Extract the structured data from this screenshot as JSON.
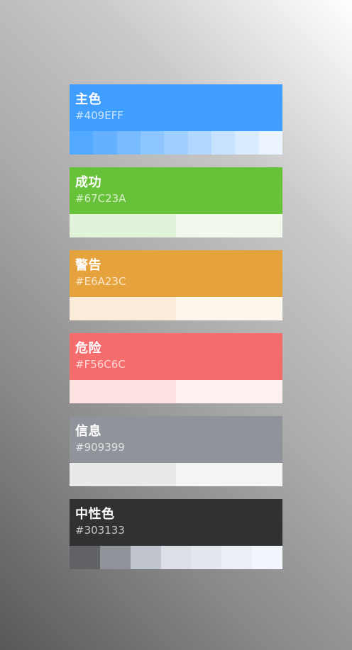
{
  "palettes": [
    {
      "name": "主色",
      "hex": "#409EFF",
      "color": "#409eff",
      "swatches": [
        "#53a8ff",
        "#66b1ff",
        "#79bbff",
        "#8cc5ff",
        "#a0cfff",
        "#b3d8ff",
        "#c6e2ff",
        "#d9ecff",
        "#ecf5ff"
      ]
    },
    {
      "name": "成功",
      "hex": "#67C23A",
      "color": "#67c23a",
      "swatches": [
        "#e1f3d8",
        "#f0f9eb"
      ]
    },
    {
      "name": "警告",
      "hex": "#E6A23C",
      "color": "#e6a23c",
      "swatches": [
        "#faecd8",
        "#fdf6ec"
      ]
    },
    {
      "name": "危险",
      "hex": "#F56C6C",
      "color": "#f56c6c",
      "swatches": [
        "#fde2e2",
        "#fef0f0"
      ]
    },
    {
      "name": "信息",
      "hex": "#909399",
      "color": "#909399",
      "swatches": [
        "#e9e9eb",
        "#f4f4f5"
      ]
    },
    {
      "name": "中性色",
      "hex": "#303133",
      "color": "#303133",
      "swatches": [
        "#606266",
        "#909399",
        "#c0c4cc",
        "#dcdfe6",
        "#e4e7ed",
        "#ebeef5",
        "#f2f6fc"
      ]
    }
  ]
}
